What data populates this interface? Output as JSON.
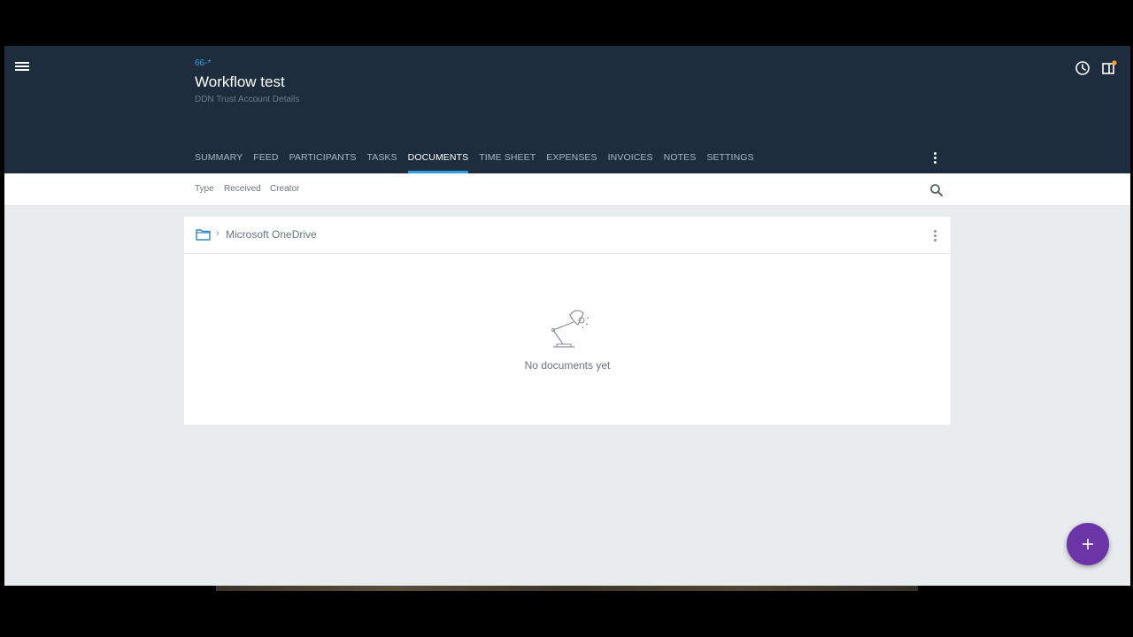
{
  "header": {
    "matter_code": "66-*",
    "title": "Workflow test",
    "subtitle": "DDN Trust Account Details",
    "history_icon": "clock-icon",
    "panel_icon": "side-panel-icon"
  },
  "tabs": [
    {
      "label": "SUMMARY"
    },
    {
      "label": "FEED"
    },
    {
      "label": "PARTICIPANTS"
    },
    {
      "label": "TASKS"
    },
    {
      "label": "DOCUMENTS",
      "active": true
    },
    {
      "label": "TIME SHEET"
    },
    {
      "label": "EXPENSES"
    },
    {
      "label": "INVOICES"
    },
    {
      "label": "NOTES"
    },
    {
      "label": "SETTINGS"
    }
  ],
  "filters": {
    "type": "Type",
    "received": "Received",
    "creator": "Creator"
  },
  "documents": {
    "breadcrumb_sep": "›",
    "breadcrumb": "Microsoft OneDrive",
    "empty_text": "No documents yet"
  },
  "colors": {
    "header_bg": "#1e2d3d",
    "active_tab_underline": "#2f9be0",
    "fab": "#6b35a8",
    "notification_dot": "#f5a623"
  }
}
